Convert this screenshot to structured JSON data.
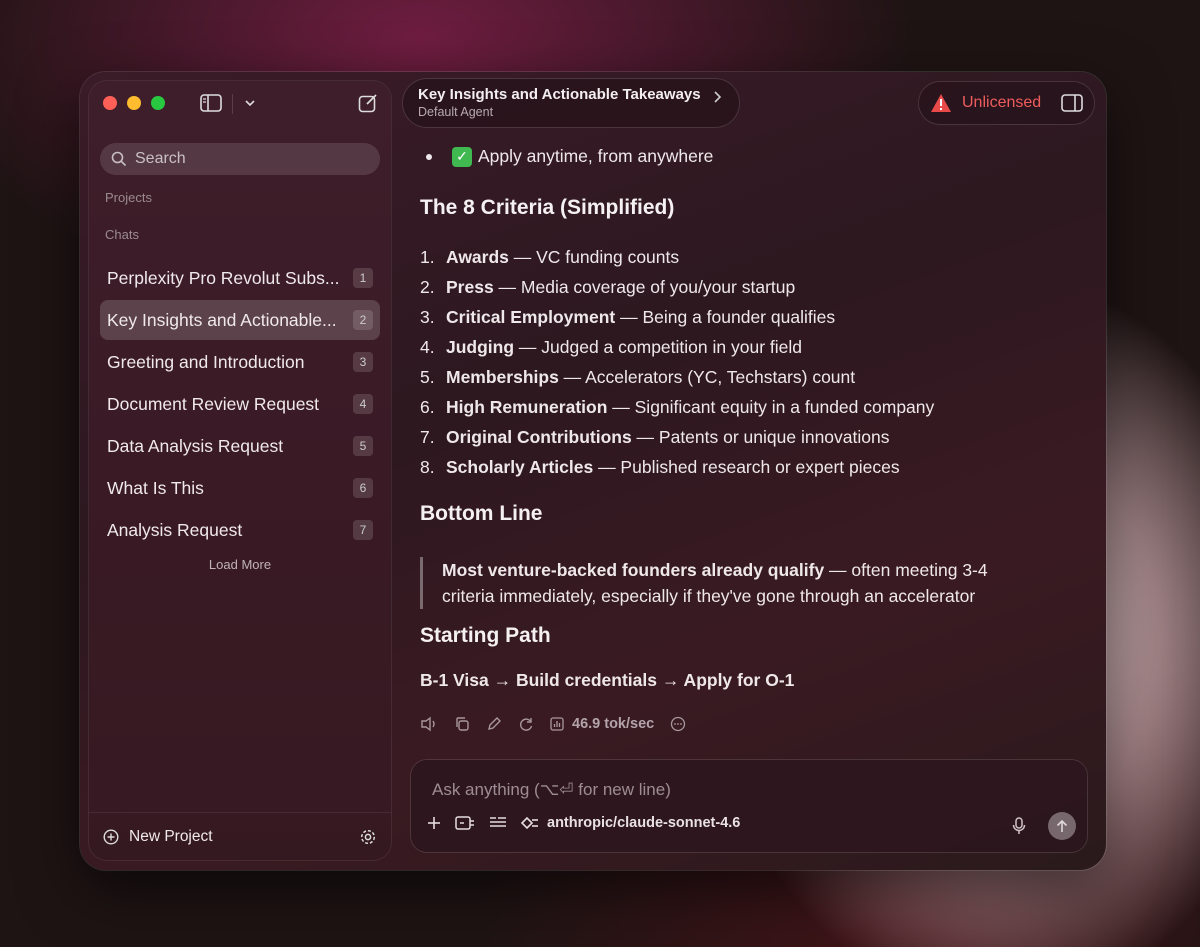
{
  "sidebar": {
    "search_placeholder": "Search",
    "projects_label": "Projects",
    "chats_label": "Chats",
    "chats": [
      {
        "label": "Perplexity Pro Revolut Subs...",
        "num": "1",
        "active": false
      },
      {
        "label": "Key Insights and Actionable...",
        "num": "2",
        "active": true
      },
      {
        "label": "Greeting and Introduction",
        "num": "3",
        "active": false
      },
      {
        "label": "Document Review Request",
        "num": "4",
        "active": false
      },
      {
        "label": "Data Analysis Request",
        "num": "5",
        "active": false
      },
      {
        "label": "What Is This",
        "num": "6",
        "active": false
      },
      {
        "label": "Analysis Request",
        "num": "7",
        "active": false
      }
    ],
    "load_more": "Load More",
    "new_project": "New Project"
  },
  "header": {
    "title": "Key Insights and Actionable Takeaways",
    "subtitle": "Default Agent",
    "license_status": "Unlicensed"
  },
  "content": {
    "bullet": "Apply anytime, from anywhere",
    "criteria_heading": "The 8 Criteria (Simplified)",
    "criteria": [
      {
        "n": "1.",
        "term": "Awards",
        "desc": " — VC funding counts"
      },
      {
        "n": "2.",
        "term": "Press",
        "desc": " — Media coverage of you/your startup"
      },
      {
        "n": "3.",
        "term": "Critical Employment",
        "desc": " — Being a founder qualifies"
      },
      {
        "n": "4.",
        "term": "Judging",
        "desc": " — Judged a competition in your field"
      },
      {
        "n": "5.",
        "term": "Memberships",
        "desc": " — Accelerators (YC, Techstars) count"
      },
      {
        "n": "6.",
        "term": "High Remuneration",
        "desc": " — Significant equity in a funded company"
      },
      {
        "n": "7.",
        "term": "Original Contributions",
        "desc": " — Patents or unique innovations"
      },
      {
        "n": "8.",
        "term": "Scholarly Articles",
        "desc": " — Published research or expert pieces"
      }
    ],
    "bottom_heading": "Bottom Line",
    "quote_bold": "Most venture-backed founders already qualify",
    "quote_rest": " — often meeting 3-4 criteria immediately, especially if they've gone through an accelerator",
    "path_heading": "Starting Path",
    "path_text": "B-1 Visa → Build credentials → Apply for O-1"
  },
  "actions": {
    "speed": "46.9 tok/sec"
  },
  "composer": {
    "placeholder": "Ask anything (⌥⏎ for new line)",
    "model": "anthropic/claude-sonnet-4.6"
  }
}
